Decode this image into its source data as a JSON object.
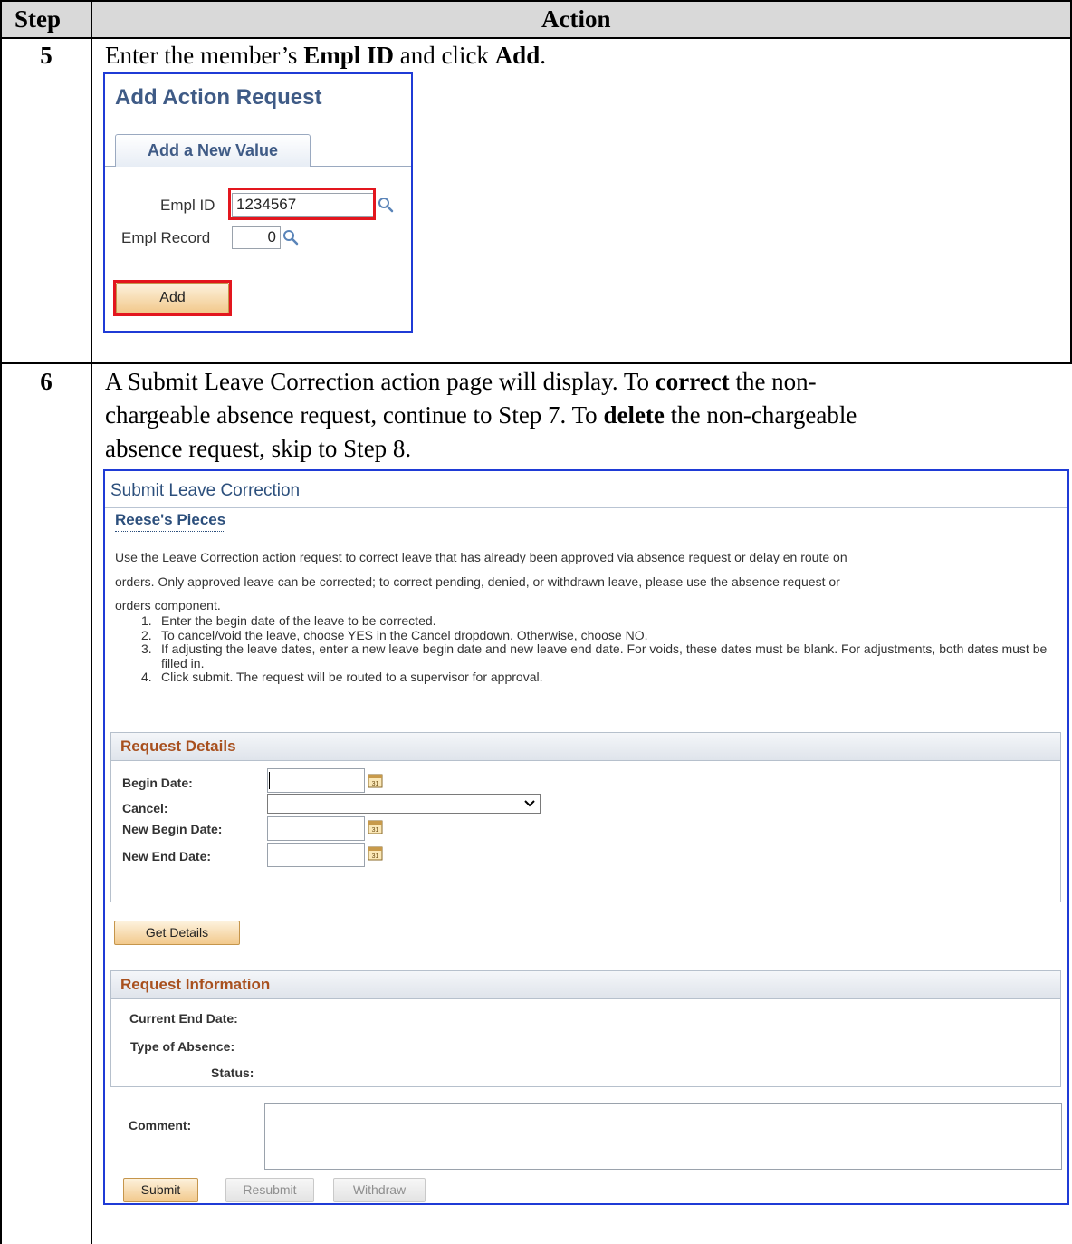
{
  "table": {
    "header_step": "Step",
    "header_action": "Action"
  },
  "step5": {
    "number": "5",
    "text_pre": "Enter the member’s ",
    "text_bold1": "Empl ID",
    "text_mid": " and click ",
    "text_bold2": "Add",
    "text_post": ".",
    "shot": {
      "title": "Add Action Request",
      "tab_label": "Add a New Value",
      "empl_id_label": "Empl ID",
      "empl_id_value": "1234567",
      "empl_record_label": "Empl Record",
      "empl_record_value": "0",
      "add_button": "Add"
    }
  },
  "step6": {
    "number": "6",
    "line1_pre": "A Submit Leave Correction action page will display. To ",
    "line1_bold": "correct",
    "line1_post": " the non-",
    "line2_pre": "chargeable absence request, continue to Step 7. To ",
    "line2_bold": "delete",
    "line2_post": " the non-chargeable",
    "line3": "absence request, skip to Step 8.",
    "shot": {
      "page_title": "Submit Leave Correction",
      "link": "Reese's Pieces",
      "desc_line1": "Use the Leave Correction action request to correct leave that has already been approved via absence request or delay en route on",
      "desc_line2": "orders. Only approved leave can be corrected; to correct pending, denied, or withdrawn leave, please use the absence request or",
      "desc_line3": "orders component.",
      "instructions": [
        {
          "n": "1.",
          "text": "Enter the begin date of the leave to be corrected."
        },
        {
          "n": "2.",
          "text": "To cancel/void the leave, choose YES in the Cancel dropdown. Otherwise, choose NO."
        },
        {
          "n": "3.",
          "text": "If adjusting the leave dates, enter a new leave begin date and new leave end date. For voids, these dates must be blank. For adjustments, both dates must be filled in."
        },
        {
          "n": "4.",
          "text": "Click submit. The request will be routed to a supervisor for approval."
        }
      ],
      "request_details": {
        "title": "Request Details",
        "begin_date": "Begin Date:",
        "cancel": "Cancel:",
        "new_begin_date": "New Begin Date:",
        "new_end_date": "New End Date:"
      },
      "get_details_button": "Get Details",
      "request_information": {
        "title": "Request Information",
        "current_end_date": "Current End Date:",
        "type_of_absence": "Type of Absence:",
        "status": "Status:"
      },
      "comment_label": "Comment:",
      "buttons": {
        "submit": "Submit",
        "resubmit": "Resubmit",
        "withdraw": "Withdraw"
      }
    }
  },
  "colors": {
    "frame_blue": "#1f3bd6",
    "highlight_red": "#e3161e",
    "section_title_orange": "#a8501e",
    "title_blue": "#2c4f7c"
  }
}
